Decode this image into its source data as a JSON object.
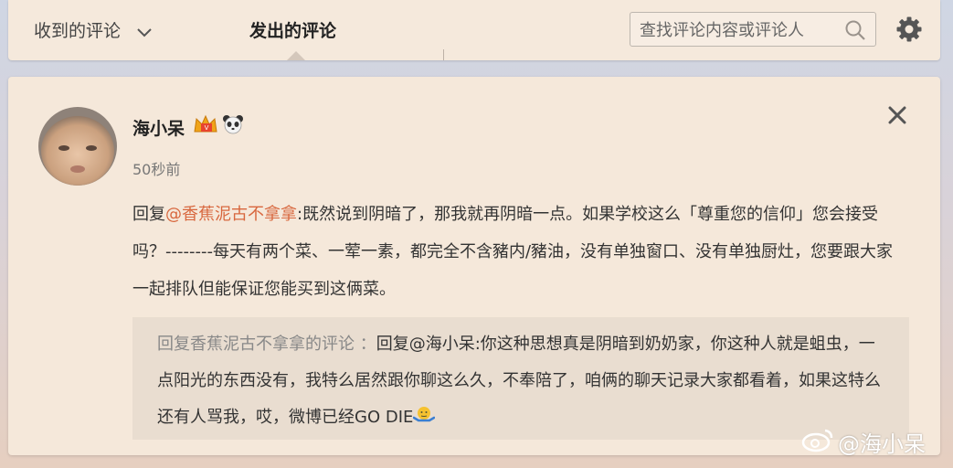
{
  "header": {
    "received_tab": "收到的评论",
    "sent_tab": "发出的评论",
    "search_placeholder": "查找评论内容或评论人",
    "icons": [
      "chevron-down-icon",
      "search-icon",
      "gear-icon"
    ]
  },
  "comment": {
    "username": "海小呆",
    "time": "50秒前",
    "reply_prefix": "回复",
    "mention": "@香蕉泥古不拿拿",
    "body": ":既然说到阴暗了，那我就再阴暗一点。如果学校这么「尊重您的信仰」您会接受吗？--------每天有两个菜、一荤一素，都完全不含豬内/豬油，没有单独窗口、没有单独厨灶，您要跟大家一起排队但能保证您能买到这俩菜。",
    "quote_ref": "回复香蕉泥古不拿拿的评论 ：",
    "quote_text": "回复@海小呆:你这种思想真是阴暗到奶奶家，你这种人就是蛆虫，一点阳光的东西没有，我特么居然跟你聊这么久，不奉陪了，咱俩的聊天记录大家都看着，如果这特么还有人骂我，哎，微博已经GO DIE",
    "badge_icons": [
      "vip-crown-icon",
      "panda-icon"
    ],
    "quote_emoji": "🤷"
  },
  "watermark": "@海小呆"
}
